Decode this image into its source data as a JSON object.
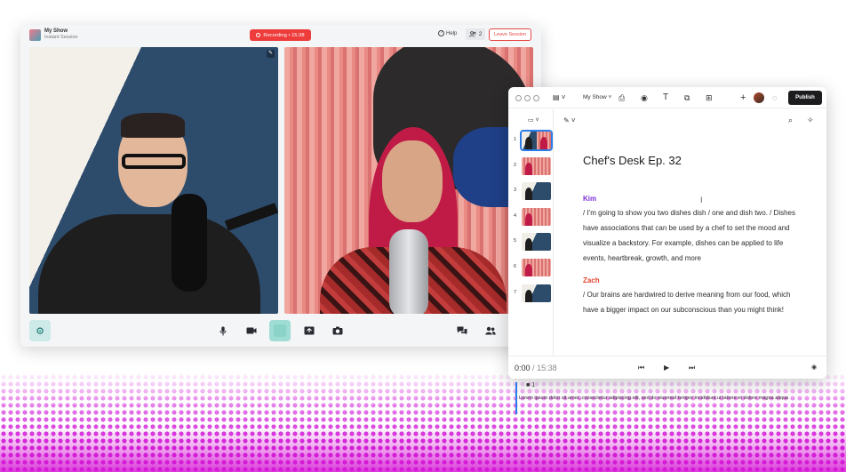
{
  "session": {
    "show_name": "My Show",
    "session_type": "Instant Session",
    "recording_label": "Recording • 15:38",
    "help_label": "Help",
    "participants_count": "2",
    "leave_label": "Leave Session"
  },
  "editor": {
    "title_menu": "My Show",
    "publish_label": "Publish",
    "doc_title": "Chef's Desk Ep. 32",
    "scene_numbers": [
      "1",
      "2",
      "3",
      "4",
      "5",
      "6",
      "7"
    ],
    "blocks": [
      {
        "speaker": "Kim",
        "speaker_color": "#7b2fd6",
        "text": "/ I'm going to show you two dishes dish / one and dish two. / Dishes have associations that can be used by a chef to set the mood and visualize a backstory. For example, dishes can be applied to life events, heartbreak, growth, and more"
      },
      {
        "speaker": "Zach",
        "speaker_color": "#e0442d",
        "text": "/ Our brains are hardwired to derive meaning from our food, which have a bigger impact on our subconscious than you might think!"
      }
    ],
    "player": {
      "current": "0:00",
      "separator": "/",
      "total": "15:38"
    }
  },
  "timeline": {
    "track_label": "1",
    "caption": "Lorem ipsum dolor sit amet, consectetur adipiscing elit, sed do eiusmod tempor incididunt ut labore et dolore magna aliqua"
  },
  "colors": {
    "accent_teal": "#13756f",
    "record_red": "#ee3b3b",
    "halftone_magenta": "#d21fd8",
    "timeline_blue": "#2b7de9"
  }
}
